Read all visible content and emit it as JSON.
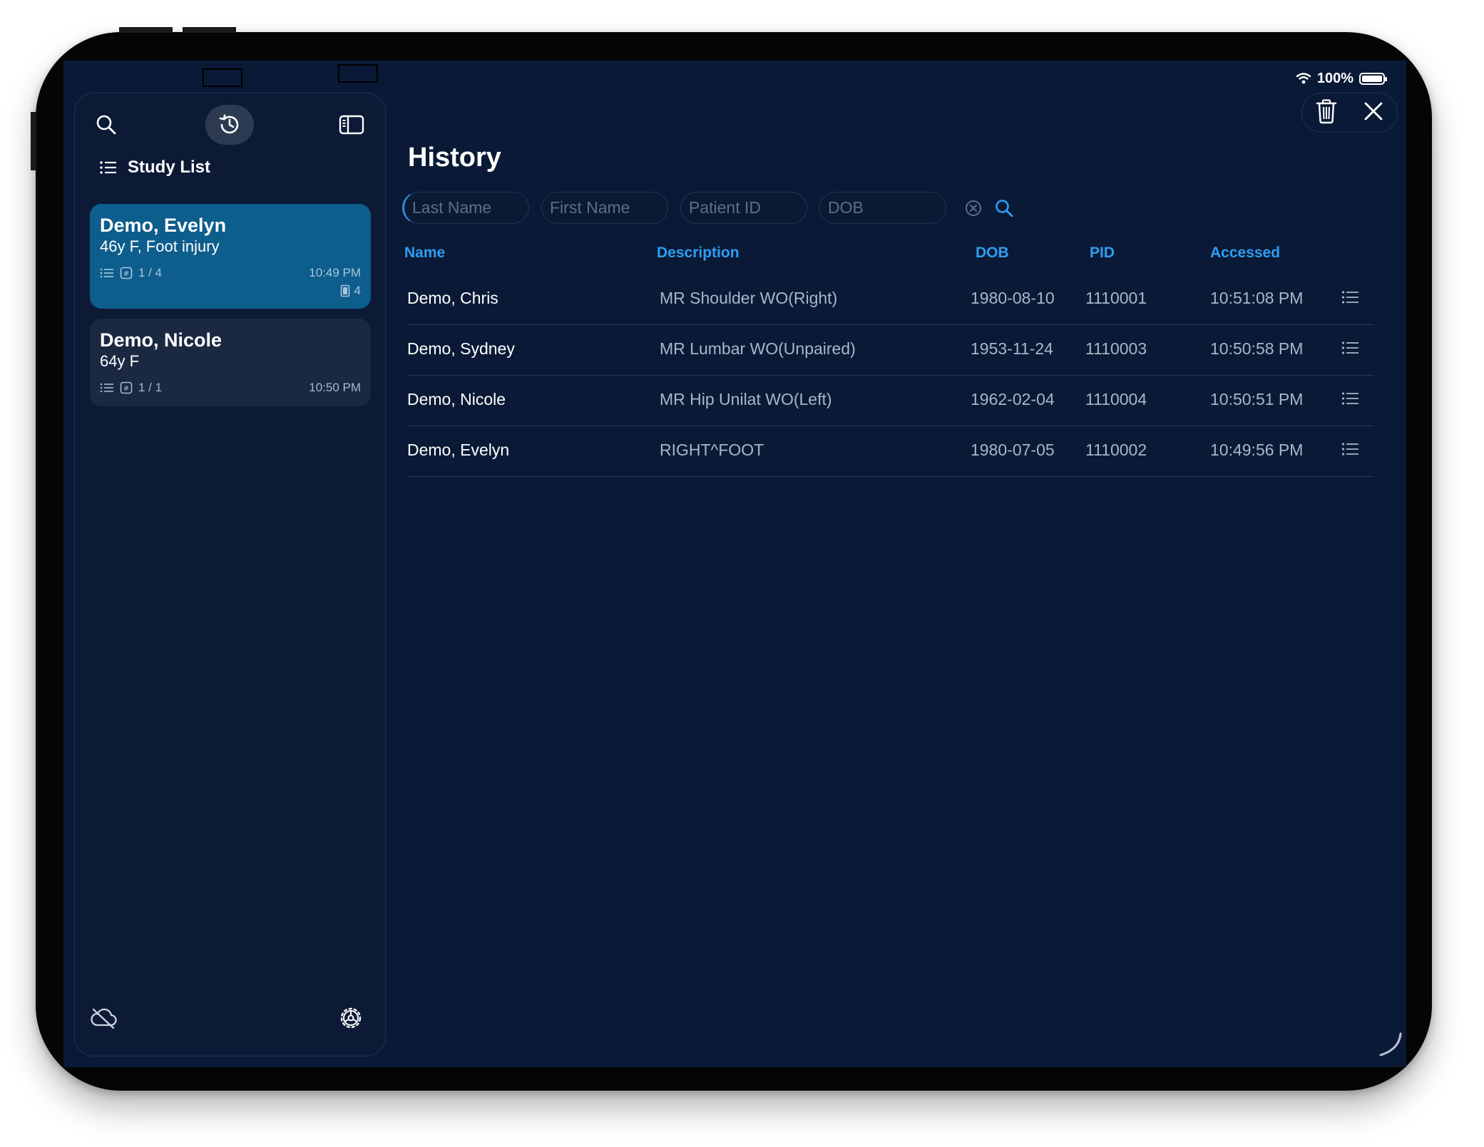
{
  "status_bar": {
    "battery_percent": "100%"
  },
  "sidebar": {
    "section_title": "Study List",
    "studies": [
      {
        "name": "Demo, Evelyn",
        "subtitle": "46y F, Foot injury",
        "series": "1 / 4",
        "time": "10:49 PM",
        "image_count": "4",
        "selected": true
      },
      {
        "name": "Demo, Nicole",
        "subtitle": "64y F",
        "series": "1 / 1",
        "time": "10:50 PM",
        "selected": false
      }
    ]
  },
  "main": {
    "title": "History",
    "search": {
      "last_name_placeholder": "Last Name",
      "first_name_placeholder": "First Name",
      "patient_id_placeholder": "Patient ID",
      "dob_placeholder": "DOB"
    },
    "table": {
      "columns": [
        "Name",
        "Description",
        "DOB",
        "PID",
        "Accessed"
      ],
      "rows": [
        {
          "name": "Demo, Chris",
          "description": "MR Shoulder WO(Right)",
          "dob": "1980-08-10",
          "pid": "1110001",
          "accessed": "10:51:08 PM"
        },
        {
          "name": "Demo, Sydney",
          "description": "MR Lumbar WO(Unpaired)",
          "dob": "1953-11-24",
          "pid": "1110003",
          "accessed": "10:50:58 PM"
        },
        {
          "name": "Demo, Nicole",
          "description": "MR Hip Unilat WO(Left)",
          "dob": "1962-02-04",
          "pid": "1110004",
          "accessed": "10:50:51 PM"
        },
        {
          "name": "Demo, Evelyn",
          "description": "RIGHT^FOOT",
          "dob": "1980-07-05",
          "pid": "1110002",
          "accessed": "10:49:56 PM"
        }
      ]
    }
  },
  "icons": {
    "sidebar_search": "search-icon",
    "sidebar_history": "history-icon",
    "sidebar_panel": "sidebar-toggle-icon",
    "cloud": "cloud-off-icon",
    "settings": "gear-icon",
    "trash": "trash-icon",
    "close": "close-icon",
    "row_menu": "list-icon"
  },
  "colors": {
    "background": "#0a1a36",
    "selected_card": "#0d5d8d",
    "accent": "#2f9df2"
  }
}
